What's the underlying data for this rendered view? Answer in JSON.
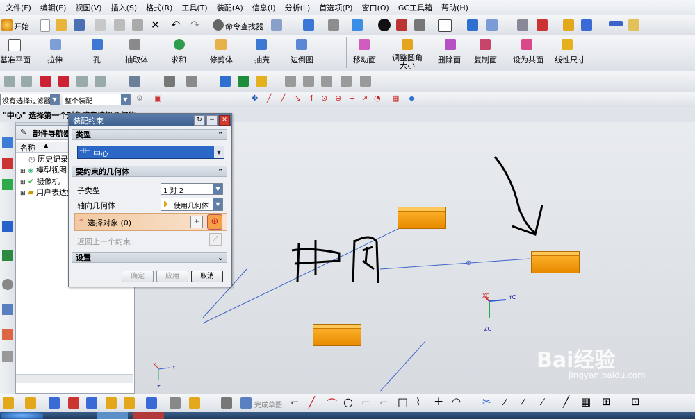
{
  "menu": [
    "文件(F)",
    "编辑(E)",
    "视图(V)",
    "插入(S)",
    "格式(R)",
    "工具(T)",
    "装配(A)",
    "信息(I)",
    "分析(L)",
    "首选项(P)",
    "窗口(O)",
    "GC工具箱",
    "帮助(H)"
  ],
  "toolbar1": {
    "start_label": "开始",
    "command_finder_label": "命令查找器"
  },
  "toolbar2": {
    "items": [
      "基准平面",
      "拉伸",
      "孔",
      "抽取体",
      "求和",
      "修剪体",
      "抽壳",
      "边倒圆",
      "移动面",
      "调整圆角大小",
      "删除面",
      "复制面",
      "设为共面",
      "线性尺寸"
    ]
  },
  "selection_bar": {
    "filter_value": "没有选择过滤器",
    "scope_value": "整个装配"
  },
  "cue_line": "\"中心\" 选择第一个对象或者选择几何体",
  "nav_panel": {
    "title": "部件导航器",
    "column_header": "名称",
    "items": [
      "历史记录模式",
      "模型视图",
      "摄像机",
      "用户表达式"
    ]
  },
  "dialog": {
    "title": "装配约束",
    "section_type": "类型",
    "type_value": "中心",
    "section_geometry": "要约束的几何体",
    "subtype_label": "子类型",
    "subtype_value": "1 对 2",
    "axis_label": "轴向几何体",
    "axis_value": "使用几何体",
    "select_object_label": "选择对象 (0)",
    "return_label": "返回上一个约束",
    "section_settings": "设置",
    "ok": "确定",
    "apply": "应用",
    "cancel": "取消"
  },
  "viewport": {
    "annotation_text": "中间",
    "triad_labels": [
      "XC",
      "YC",
      "ZC"
    ],
    "small_triad_labels": [
      "X",
      "Y",
      "Z"
    ]
  },
  "bottom_bar": {
    "finish_sketch_label": "完成草图"
  },
  "watermark": {
    "brand": "Bai经验",
    "url": "jingyan.baidu.com"
  },
  "colors": {
    "block": "#f09a10",
    "accent": "#1a5fc4",
    "constraint_line": "#3f63c8"
  }
}
